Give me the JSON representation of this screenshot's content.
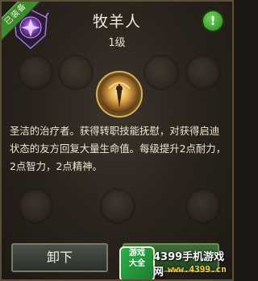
{
  "ribbon": {
    "label": "已装备"
  },
  "header": {
    "title": "牧羊人",
    "level": "1级",
    "info_icon": "!"
  },
  "skill": {
    "icon": "shepherd-skill-icon"
  },
  "description": "圣洁的治疗者。获得转职技能抚慰，对获得启迪状态的友方回复大量生命值。每级提升2点耐力，2点智力，2点精神。",
  "buttons": {
    "unequip": "卸下"
  },
  "watermark": {
    "logo_top": "游戏",
    "logo_bottom": "大全",
    "text": "4399手机游戏网",
    "url": "www.4399.cn"
  },
  "colors": {
    "accent_green": "#3f8a2e",
    "text": "#efe6d2",
    "panel_border": "#5b4d38"
  }
}
